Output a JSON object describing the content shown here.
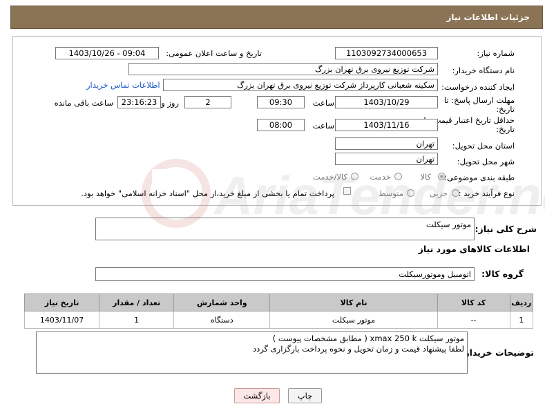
{
  "header": {
    "title": "جزئیات اطلاعات نیاز"
  },
  "fields": {
    "need_number_label": "شماره نیاز:",
    "need_number": "1103092734000653",
    "announce_label": "تاریخ و ساعت اعلان عمومی:",
    "announce_value": "1403/10/26 - 09:04",
    "buyer_org_label": "نام دستگاه خریدار:",
    "buyer_org": "شرکت توزیع نیروی برق تهران بزرگ",
    "creator_label": "ایجاد کننده درخواست:",
    "creator": "سکینه شعبانی کارپرداز شرکت توزیع نیروی برق تهران بزرگ",
    "contact_link": "اطلاعات تماس خریدار",
    "deadline_label_1": "مهلت ارسال پاسخ: تا",
    "deadline_label_2": "تاریخ:",
    "deadline_date": "1403/10/29",
    "time_label": "ساعت",
    "deadline_time": "09:30",
    "days_value": "2",
    "days_label": "روز و",
    "remaining_time": "23:16:23",
    "remaining_label": "ساعت باقی مانده",
    "validity_label_1": "حداقل تاریخ اعتبار قیمت: تا",
    "validity_label_2": "تاریخ:",
    "validity_date": "1403/11/16",
    "validity_time": "08:00",
    "province_label": "استان محل تحویل:",
    "province": "تهران",
    "city_label": "شهر محل تحویل:",
    "city": "تهران",
    "category_label": "طبقه بندی موضوعی:",
    "category_options": [
      "کالا",
      "خدمت",
      "کالا/خدمت"
    ],
    "process_label": "نوع فرآیند خرید :",
    "process_options": [
      "جزیی",
      "متوسط"
    ],
    "payment_note": "پرداخت تمام یا بخشی از مبلغ خرید،از محل \"اسناد خزانه اسلامی\" خواهد بود."
  },
  "summary": {
    "label": "شرح کلی نیاز:",
    "value": "موتور سیکلت"
  },
  "goods_section_title": "اطلاعات کالاهای مورد نیاز",
  "goods_group": {
    "label": "گروه کالا:",
    "value": "اتومبیل وموتورسیکلت"
  },
  "table": {
    "headers": [
      "ردیف",
      "کد کالا",
      "نام کالا",
      "واحد شمارش",
      "تعداد / مقدار",
      "تاریخ نیاز"
    ],
    "rows": [
      [
        "1",
        "--",
        "موتور سیکلت",
        "دستگاه",
        "1",
        "1403/11/07"
      ]
    ]
  },
  "buyer_notes": {
    "label": "توضیحات خریدار:",
    "line1": "موتور سیکلت xmax 250 k  ( مطابق مشخصات پیوست )",
    "line2": "لطفا پیشنهاد قیمت و زمان تحویل و نحوه پرداخت بارگزاری گردد"
  },
  "buttons": {
    "print": "چاپ",
    "back": "بازگشت"
  },
  "watermark": {
    "text": "AriaTender.net"
  },
  "colors": {
    "header_bg": "#8b7355",
    "table_header_bg": "#c9c9c9",
    "link": "#1a55c9"
  }
}
